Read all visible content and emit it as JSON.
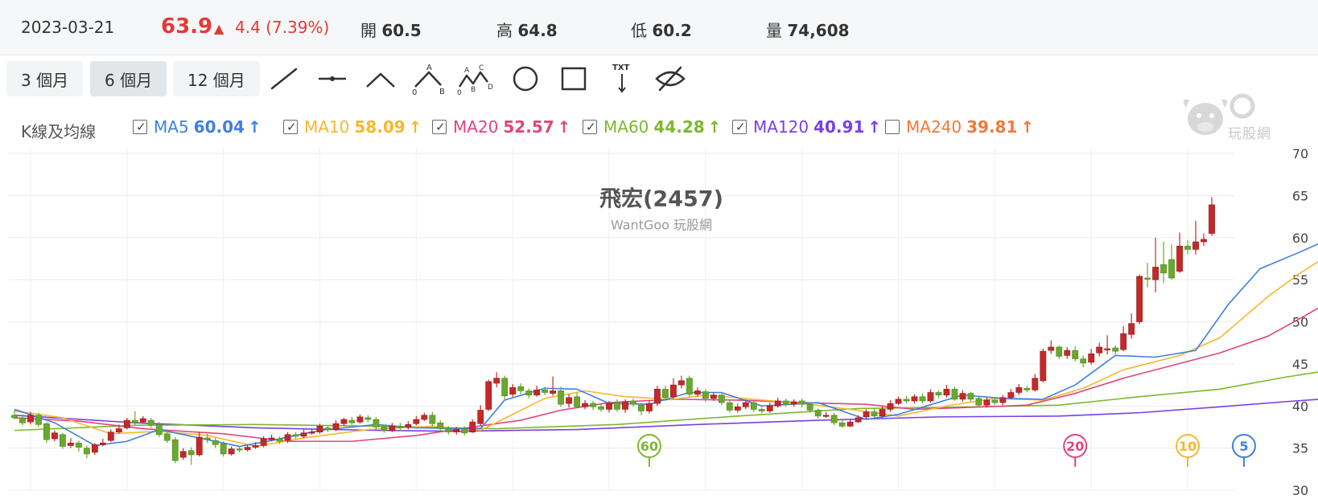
{
  "quote": {
    "date": "2023-03-21",
    "price": "63.9",
    "arrow": "▲",
    "change": "4.4 (7.39%)",
    "open_label": "開",
    "open": "60.5",
    "high_label": "高",
    "high": "64.8",
    "low_label": "低",
    "low": "60.2",
    "volume_label": "量",
    "volume": "74,608",
    "color_up": "#e53935"
  },
  "toolbar": {
    "ranges": [
      "3 個月",
      "6 個月",
      "12 個月"
    ],
    "active_range": "6 個月",
    "tool_labels": {
      "abc_a": "A",
      "abc_b": "B",
      "abc_0": "0",
      "abcd_a": "A",
      "abcd_b": "B",
      "abcd_c": "C",
      "abcd_d": "D",
      "abcd_0": "0",
      "txt": "TXT"
    }
  },
  "ma_panel": {
    "title": "K線及均線",
    "items": [
      {
        "label": "MA5",
        "value": "60.04",
        "checked": true,
        "color": "#3f7fe0"
      },
      {
        "label": "MA10",
        "value": "58.09",
        "checked": true,
        "color": "#f5b82e"
      },
      {
        "label": "MA20",
        "value": "52.57",
        "checked": true,
        "color": "#e0457f"
      },
      {
        "label": "MA60",
        "value": "44.28",
        "checked": true,
        "color": "#7cb82f"
      },
      {
        "label": "MA120",
        "value": "40.91",
        "checked": true,
        "color": "#7b3fe4"
      },
      {
        "label": "MA240",
        "value": "39.81",
        "checked": false,
        "color": "#f07a3a"
      }
    ],
    "up_arrow": "↑"
  },
  "logo": {
    "text": "玩股網"
  },
  "chart_data": {
    "type": "candlestick",
    "title": "飛宏(2457)",
    "subtitle": "WantGoo 玩股網",
    "ylim": [
      30,
      70
    ],
    "yticks": [
      30,
      35,
      40,
      45,
      50,
      55,
      60,
      65,
      70
    ],
    "grid": true,
    "candle_colors": {
      "up": "#c62828",
      "down": "#6aa82e"
    },
    "candles": [
      [
        38.9,
        38.6,
        39.5,
        38.4
      ],
      [
        38.6,
        38.0,
        39.0,
        37.7
      ],
      [
        38.1,
        38.9,
        39.3,
        37.8
      ],
      [
        38.9,
        37.8,
        39.2,
        37.5
      ],
      [
        37.9,
        36.0,
        38.1,
        35.6
      ],
      [
        36.1,
        36.8,
        37.1,
        35.8
      ],
      [
        36.6,
        35.2,
        36.8,
        34.9
      ],
      [
        35.3,
        35.6,
        36.2,
        35.0
      ],
      [
        35.6,
        35.1,
        35.9,
        34.6
      ],
      [
        35.0,
        34.3,
        35.3,
        33.8
      ],
      [
        34.5,
        35.4,
        35.6,
        34.2
      ],
      [
        35.4,
        35.6,
        36.1,
        35.2
      ],
      [
        35.9,
        36.9,
        37.2,
        35.7
      ],
      [
        36.9,
        37.3,
        37.8,
        36.7
      ],
      [
        37.4,
        38.3,
        38.6,
        37.2
      ],
      [
        38.3,
        38.0,
        39.4,
        37.7
      ],
      [
        38.1,
        38.5,
        38.8,
        37.9
      ],
      [
        38.3,
        37.8,
        38.6,
        37.4
      ],
      [
        37.8,
        36.6,
        38.1,
        36.3
      ],
      [
        36.7,
        35.9,
        37.2,
        35.6
      ],
      [
        36.0,
        33.5,
        36.3,
        33.2
      ],
      [
        33.9,
        34.6,
        35.0,
        33.6
      ],
      [
        34.7,
        34.2,
        35.1,
        33.0
      ],
      [
        34.2,
        36.3,
        36.9,
        34.0
      ],
      [
        36.2,
        36.0,
        36.7,
        35.6
      ],
      [
        35.9,
        35.4,
        36.2,
        35.0
      ],
      [
        35.5,
        34.3,
        35.8,
        34.0
      ],
      [
        34.3,
        34.9,
        35.2,
        34.1
      ],
      [
        34.9,
        34.8,
        35.3,
        34.5
      ],
      [
        34.8,
        35.1,
        35.4,
        34.6
      ],
      [
        35.1,
        35.3,
        35.7,
        34.9
      ],
      [
        35.3,
        36.1,
        36.4,
        35.1
      ],
      [
        36.0,
        36.2,
        36.6,
        35.8
      ],
      [
        36.1,
        35.8,
        36.4,
        35.5
      ],
      [
        35.9,
        36.6,
        36.9,
        35.6
      ],
      [
        36.6,
        36.4,
        36.9,
        36.1
      ],
      [
        36.4,
        36.8,
        37.2,
        36.2
      ],
      [
        36.8,
        36.9,
        37.3,
        36.6
      ],
      [
        36.9,
        37.6,
        37.9,
        36.7
      ],
      [
        37.4,
        37.2,
        37.6,
        36.9
      ],
      [
        37.2,
        37.9,
        38.3,
        37.0
      ],
      [
        37.9,
        38.4,
        38.6,
        37.6
      ],
      [
        38.3,
        38.0,
        38.7,
        37.7
      ],
      [
        38.1,
        38.7,
        39.0,
        37.9
      ],
      [
        38.6,
        38.4,
        38.9,
        38.1
      ],
      [
        38.4,
        37.5,
        38.7,
        37.2
      ],
      [
        37.5,
        37.1,
        37.8,
        36.8
      ],
      [
        37.1,
        37.6,
        38.0,
        36.9
      ],
      [
        37.6,
        37.4,
        38.0,
        37.1
      ],
      [
        37.5,
        37.8,
        38.2,
        37.2
      ],
      [
        37.9,
        38.4,
        38.8,
        37.7
      ],
      [
        38.4,
        38.9,
        39.2,
        38.2
      ],
      [
        38.9,
        37.9,
        39.3,
        37.6
      ],
      [
        38.0,
        37.3,
        38.3,
        37.0
      ],
      [
        37.3,
        36.9,
        37.6,
        36.6
      ],
      [
        36.9,
        37.2,
        37.5,
        36.6
      ],
      [
        37.3,
        36.8,
        37.6,
        36.5
      ],
      [
        36.9,
        38.1,
        38.4,
        36.8
      ],
      [
        37.9,
        39.5,
        40.1,
        37.7
      ],
      [
        39.6,
        42.9,
        43.1,
        39.4
      ],
      [
        42.7,
        43.3,
        44.0,
        42.2
      ],
      [
        43.3,
        41.2,
        43.6,
        40.8
      ],
      [
        41.4,
        42.2,
        42.6,
        41.1
      ],
      [
        42.3,
        41.8,
        42.7,
        41.4
      ],
      [
        41.8,
        41.3,
        42.1,
        40.9
      ],
      [
        41.3,
        41.9,
        42.4,
        41.1
      ],
      [
        41.9,
        41.6,
        42.3,
        41.3
      ],
      [
        41.5,
        41.8,
        43.5,
        41.2
      ],
      [
        41.8,
        40.2,
        42.3,
        39.9
      ],
      [
        40.3,
        41.0,
        41.4,
        39.8
      ],
      [
        41.1,
        39.9,
        41.6,
        39.7
      ],
      [
        39.9,
        40.3,
        40.7,
        39.6
      ],
      [
        40.3,
        39.9,
        40.6,
        39.5
      ],
      [
        39.9,
        39.6,
        40.3,
        39.3
      ],
      [
        39.6,
        40.3,
        40.6,
        39.2
      ],
      [
        40.4,
        39.6,
        40.8,
        39.3
      ],
      [
        39.6,
        40.5,
        40.8,
        39.2
      ],
      [
        40.6,
        40.2,
        40.9,
        39.9
      ],
      [
        40.1,
        39.4,
        40.4,
        38.9
      ],
      [
        39.4,
        40.3,
        40.7,
        39.1
      ],
      [
        40.3,
        42.0,
        42.4,
        40.0
      ],
      [
        42.0,
        41.0,
        42.4,
        40.6
      ],
      [
        41.1,
        42.5,
        43.3,
        40.8
      ],
      [
        42.5,
        43.0,
        43.6,
        42.1
      ],
      [
        43.3,
        41.4,
        43.6,
        41.0
      ],
      [
        41.4,
        41.8,
        42.2,
        41.1
      ],
      [
        41.7,
        40.9,
        42.0,
        40.5
      ],
      [
        40.9,
        41.3,
        41.6,
        40.6
      ],
      [
        41.3,
        40.4,
        41.6,
        40.1
      ],
      [
        40.4,
        39.5,
        40.7,
        39.2
      ],
      [
        39.5,
        39.9,
        40.3,
        39.2
      ],
      [
        39.9,
        40.4,
        40.8,
        39.6
      ],
      [
        40.4,
        39.6,
        40.6,
        39.3
      ],
      [
        39.6,
        39.4,
        39.9,
        39.1
      ],
      [
        39.4,
        40.0,
        40.4,
        39.2
      ],
      [
        40.0,
        40.6,
        41.0,
        39.8
      ],
      [
        40.6,
        40.2,
        40.9,
        39.9
      ],
      [
        40.2,
        40.5,
        40.8,
        39.9
      ],
      [
        40.6,
        40.2,
        40.9,
        39.8
      ],
      [
        40.2,
        39.5,
        40.4,
        39.2
      ],
      [
        39.5,
        38.8,
        39.7,
        38.5
      ],
      [
        38.8,
        38.9,
        39.3,
        38.6
      ],
      [
        38.9,
        38.0,
        39.2,
        37.7
      ],
      [
        38.0,
        37.6,
        38.3,
        37.4
      ],
      [
        37.6,
        38.1,
        38.4,
        37.5
      ],
      [
        38.1,
        38.6,
        38.9,
        38.0
      ],
      [
        38.7,
        39.3,
        39.6,
        38.5
      ],
      [
        39.3,
        38.8,
        39.8,
        38.6
      ],
      [
        38.8,
        39.6,
        40.0,
        38.6
      ],
      [
        39.6,
        40.3,
        40.7,
        39.3
      ],
      [
        40.3,
        40.8,
        41.1,
        40.1
      ],
      [
        40.8,
        40.6,
        41.2,
        40.3
      ],
      [
        40.6,
        41.1,
        41.4,
        40.3
      ],
      [
        41.1,
        40.6,
        41.5,
        40.3
      ],
      [
        40.6,
        41.6,
        42.0,
        40.4
      ],
      [
        41.6,
        41.3,
        41.9,
        40.9
      ],
      [
        41.3,
        42.0,
        42.5,
        41.0
      ],
      [
        42.0,
        40.8,
        42.3,
        40.6
      ],
      [
        40.8,
        41.5,
        41.9,
        40.5
      ],
      [
        41.5,
        40.8,
        41.7,
        40.5
      ],
      [
        40.9,
        40.1,
        41.1,
        39.8
      ],
      [
        40.1,
        40.7,
        41.0,
        39.8
      ],
      [
        40.7,
        40.4,
        41.0,
        40.1
      ],
      [
        40.4,
        41.0,
        41.3,
        40.1
      ],
      [
        41.0,
        41.6,
        42.0,
        40.8
      ],
      [
        41.6,
        42.2,
        42.6,
        41.3
      ],
      [
        42.1,
        41.9,
        42.4,
        41.6
      ],
      [
        41.9,
        43.3,
        43.8,
        41.7
      ],
      [
        43.0,
        46.5,
        46.8,
        42.8
      ],
      [
        46.6,
        47.0,
        47.8,
        46.2
      ],
      [
        47.0,
        45.9,
        47.2,
        45.6
      ],
      [
        46.0,
        46.6,
        47.0,
        45.6
      ],
      [
        46.6,
        45.6,
        47.1,
        45.3
      ],
      [
        45.6,
        45.1,
        46.0,
        44.6
      ],
      [
        45.2,
        46.2,
        46.8,
        44.9
      ],
      [
        46.3,
        47.0,
        47.5,
        45.9
      ],
      [
        46.8,
        46.8,
        48.4,
        46.1
      ],
      [
        46.9,
        46.5,
        47.2,
        46.1
      ],
      [
        46.7,
        48.6,
        49.5,
        46.5
      ],
      [
        48.5,
        49.8,
        51.0,
        48.0
      ],
      [
        50.0,
        55.4,
        55.6,
        49.7
      ],
      [
        55.2,
        55.1,
        57.0,
        54.1
      ],
      [
        55.0,
        56.5,
        60.0,
        53.5
      ],
      [
        56.8,
        55.8,
        59.5,
        54.6
      ],
      [
        57.4,
        55.2,
        59.2,
        55.0
      ],
      [
        56.0,
        59.0,
        60.6,
        55.8
      ],
      [
        59.0,
        58.6,
        59.7,
        58.0
      ],
      [
        58.6,
        59.5,
        62.0,
        58.0
      ],
      [
        59.5,
        59.8,
        60.5,
        59.0
      ],
      [
        60.5,
        63.9,
        64.8,
        60.2
      ]
    ],
    "ma5": [
      [
        0,
        39.6
      ],
      [
        5,
        38.0
      ],
      [
        10,
        35.3
      ],
      [
        14,
        35.8
      ],
      [
        18,
        37.2
      ],
      [
        23,
        36.2
      ],
      [
        28,
        35.2
      ],
      [
        32,
        35.9
      ],
      [
        38,
        37.1
      ],
      [
        45,
        37.8
      ],
      [
        50,
        37.4
      ],
      [
        58,
        37.3
      ],
      [
        61,
        40.7
      ],
      [
        66,
        42.1
      ],
      [
        70,
        42.0
      ],
      [
        74,
        40.3
      ],
      [
        79,
        40.2
      ],
      [
        84,
        41.6
      ],
      [
        88,
        41.6
      ],
      [
        93,
        40.0
      ],
      [
        100,
        40.4
      ],
      [
        106,
        38.4
      ],
      [
        110,
        39.0
      ],
      [
        118,
        41.3
      ],
      [
        123,
        40.9
      ],
      [
        128,
        40.8
      ],
      [
        132,
        42.5
      ],
      [
        137,
        46.0
      ],
      [
        142,
        45.8
      ],
      [
        147,
        46.6
      ],
      [
        151,
        52.0
      ],
      [
        155,
        56.3
      ],
      [
        160,
        58.3
      ],
      [
        164,
        60.0
      ]
    ],
    "ma10": [
      [
        0,
        39.4
      ],
      [
        6,
        38.6
      ],
      [
        12,
        36.7
      ],
      [
        18,
        37.0
      ],
      [
        24,
        36.5
      ],
      [
        30,
        35.2
      ],
      [
        36,
        36.2
      ],
      [
        44,
        37.2
      ],
      [
        52,
        37.6
      ],
      [
        58,
        37.1
      ],
      [
        62,
        39.0
      ],
      [
        66,
        40.9
      ],
      [
        71,
        41.8
      ],
      [
        76,
        41.1
      ],
      [
        82,
        40.8
      ],
      [
        86,
        41.3
      ],
      [
        92,
        40.8
      ],
      [
        98,
        40.3
      ],
      [
        104,
        39.6
      ],
      [
        110,
        38.8
      ],
      [
        116,
        40.0
      ],
      [
        122,
        40.9
      ],
      [
        128,
        40.7
      ],
      [
        133,
        42.1
      ],
      [
        138,
        44.3
      ],
      [
        145,
        46.0
      ],
      [
        150,
        48.1
      ],
      [
        156,
        53.0
      ],
      [
        160,
        55.8
      ],
      [
        164,
        58.2
      ]
    ],
    "ma20": [
      [
        0,
        38.6
      ],
      [
        8,
        38.2
      ],
      [
        16,
        37.3
      ],
      [
        26,
        36.7
      ],
      [
        34,
        35.8
      ],
      [
        42,
        35.8
      ],
      [
        50,
        36.5
      ],
      [
        57,
        37.5
      ],
      [
        63,
        38.3
      ],
      [
        68,
        39.5
      ],
      [
        74,
        40.4
      ],
      [
        82,
        40.8
      ],
      [
        90,
        40.7
      ],
      [
        98,
        40.4
      ],
      [
        106,
        40.2
      ],
      [
        112,
        39.6
      ],
      [
        118,
        39.8
      ],
      [
        126,
        40.1
      ],
      [
        132,
        41.5
      ],
      [
        138,
        43.3
      ],
      [
        144,
        44.8
      ],
      [
        150,
        46.3
      ],
      [
        156,
        48.3
      ],
      [
        160,
        50.4
      ],
      [
        164,
        52.6
      ]
    ],
    "ma60": [
      [
        0,
        37.1
      ],
      [
        15,
        37.7
      ],
      [
        30,
        37.8
      ],
      [
        45,
        37.6
      ],
      [
        60,
        37.3
      ],
      [
        75,
        37.8
      ],
      [
        90,
        38.8
      ],
      [
        105,
        39.7
      ],
      [
        120,
        39.9
      ],
      [
        130,
        40.1
      ],
      [
        140,
        41.1
      ],
      [
        150,
        42.0
      ],
      [
        158,
        43.4
      ],
      [
        164,
        44.3
      ]
    ],
    "ma120": [
      [
        0,
        38.9
      ],
      [
        15,
        38.0
      ],
      [
        30,
        37.4
      ],
      [
        45,
        37.1
      ],
      [
        55,
        37.0
      ],
      [
        70,
        37.2
      ],
      [
        85,
        37.8
      ],
      [
        100,
        38.3
      ],
      [
        115,
        38.7
      ],
      [
        130,
        38.8
      ],
      [
        140,
        39.2
      ],
      [
        150,
        39.9
      ],
      [
        158,
        40.5
      ],
      [
        164,
        40.9
      ]
    ],
    "ma_markers": [
      {
        "label": "60",
        "index": 79,
        "color": "#7cb82f"
      },
      {
        "label": "20",
        "index": 132,
        "color": "#e0457f"
      },
      {
        "label": "10",
        "index": 146,
        "color": "#f5b82e"
      },
      {
        "label": "5",
        "index": 153,
        "color": "#3f7fe0"
      }
    ]
  }
}
